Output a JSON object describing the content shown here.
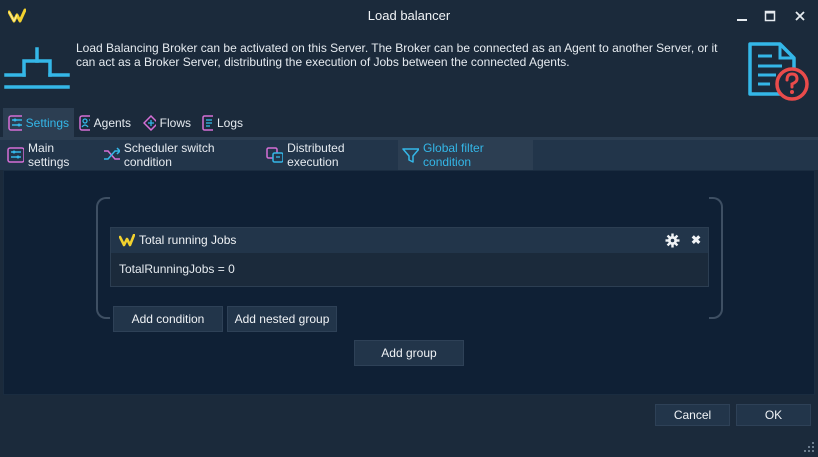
{
  "window": {
    "title": "Load balancer",
    "controls": [
      "minimize-icon",
      "maximize-icon",
      "close-icon"
    ]
  },
  "banner": {
    "description": "Load Balancing Broker can be activated on this Server. The Broker can be connected as an Agent to another Server, or it can act as a Broker Server, distributing the execution of Jobs between the connected Agents.",
    "icon": "load-balancer-icon",
    "help_icon": "help-document-icon"
  },
  "main_tabs": [
    {
      "label": "Settings",
      "icon": "settings-sliders-icon",
      "active": true
    },
    {
      "label": "Agents",
      "icon": "agents-icon",
      "active": false
    },
    {
      "label": "Flows",
      "icon": "flows-icon",
      "active": false
    },
    {
      "label": "Logs",
      "icon": "logs-icon",
      "active": false
    }
  ],
  "sub_tabs": [
    {
      "label": "Main settings",
      "icon": "sliders-icon",
      "active": false
    },
    {
      "label": "Scheduler switch condition",
      "icon": "shuffle-icon",
      "active": false
    },
    {
      "label": "Distributed execution",
      "icon": "distributed-icon",
      "active": false
    },
    {
      "label": "Global filter condition",
      "icon": "filter-icon",
      "active": true
    }
  ],
  "condition": {
    "title": "Total running Jobs",
    "expression": "TotalRunningJobs = 0",
    "close_glyph": "✖"
  },
  "buttons": {
    "add_condition": "Add condition",
    "add_nested_group": "Add nested group",
    "add_group": "Add group",
    "cancel": "Cancel",
    "ok": "OK"
  },
  "colors": {
    "background": "#1b2a3b",
    "content_background": "#0f2035",
    "accent": "#34b7e8",
    "logo_yellow": "#f2d12e",
    "help_red": "#e94b4b"
  }
}
